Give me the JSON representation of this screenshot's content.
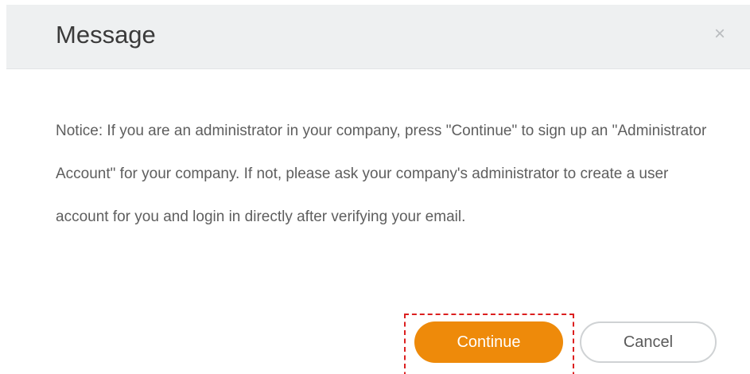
{
  "dialog": {
    "title": "Message",
    "close_glyph": "×",
    "close_icon": "close-icon",
    "message": "Notice: If you are an administrator in your company, press \"Continue\" to sign up an \"Administrator Account\" for your company. If not, please ask your company's administrator to create a user account for you and login in directly after verifying your email.",
    "buttons": {
      "continue_label": "Continue",
      "cancel_label": "Cancel"
    }
  },
  "colors": {
    "header_background": "#eef0f1",
    "primary_button": "#ee8a0a",
    "highlight_border": "#dc2020"
  }
}
